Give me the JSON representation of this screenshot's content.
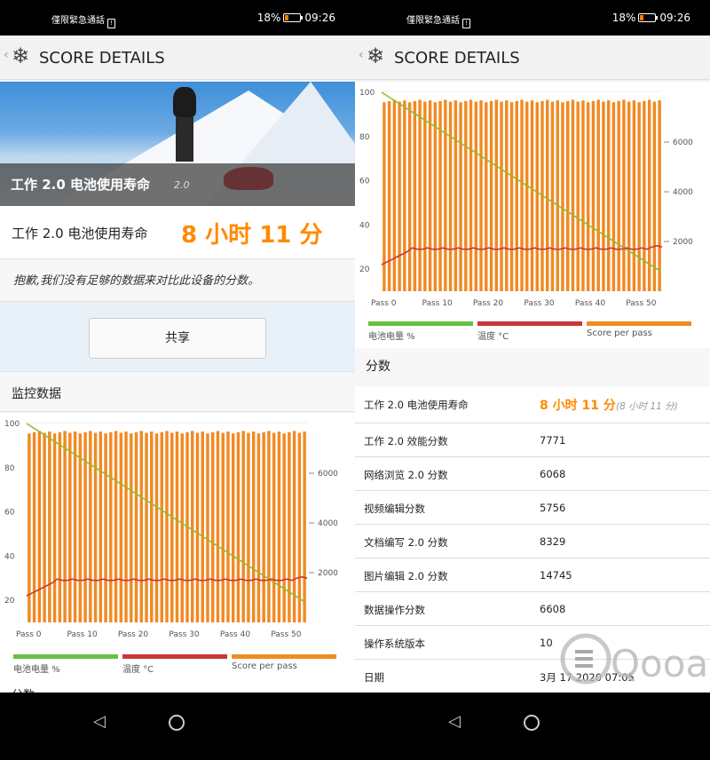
{
  "left": {
    "status": {
      "carrier": "僅限緊急通話",
      "sim_label": "!",
      "battery": "18%",
      "battery_level": 0.18,
      "time": "09:26"
    },
    "appbar": {
      "back": "‹",
      "icon": "snowflake-icon",
      "title": "SCORE DETAILS"
    },
    "hero": {
      "title": "工作 2.0 电池使用寿命",
      "version": "2.0"
    },
    "result": {
      "label": "工作 2.0 电池使用寿命",
      "value": "8 小时 11 分"
    },
    "sorry": "抱歉,我们没有足够的数据来对比此设备的分数。",
    "share_label": "共享",
    "monitor_title": "监控数据",
    "cut_heading": "分数",
    "legend": [
      {
        "label": "电池电量 %",
        "color": "#6abf40"
      },
      {
        "label": "温度 °C",
        "color": "#c8373a"
      },
      {
        "label": "Score per pass",
        "color": "#f08a24"
      }
    ]
  },
  "right": {
    "status": {
      "carrier": "僅限緊急通話",
      "sim_label": "!",
      "battery": "18%",
      "battery_level": 0.18,
      "time": "09:26"
    },
    "appbar": {
      "back": "‹",
      "icon": "snowflake-icon",
      "title": "SCORE DETAILS"
    },
    "legend": [
      {
        "label": "电池电量 %",
        "color": "#6abf40"
      },
      {
        "label": "温度 °C",
        "color": "#c8373a"
      },
      {
        "label": "Score per pass",
        "color": "#f08a24"
      }
    ],
    "score_heading": "分数",
    "rows": [
      {
        "key": "工作 2.0 电池使用寿命",
        "value": "8 小时 11 分",
        "sub": "(8 小时 11 分)"
      },
      {
        "key": "工作 2.0 效能分数",
        "value": "7771"
      },
      {
        "key": "网络浏览 2.0 分数",
        "value": "6068"
      },
      {
        "key": "视频编辑分数",
        "value": "5756"
      },
      {
        "key": "文档编写 2.0 分数",
        "value": "8329"
      },
      {
        "key": "图片编辑 2.0 分数",
        "value": "14745"
      },
      {
        "key": "数据操作分数",
        "value": "6608"
      },
      {
        "key": "操作系统版本",
        "value": "10"
      },
      {
        "key": "日期",
        "value": "3月 17 2020 07:05"
      }
    ],
    "watermark": "Qooah"
  },
  "chart_data": {
    "type": "bar",
    "passes": 55,
    "xtick_labels": [
      "Pass 0",
      "Pass 10",
      "Pass 20",
      "Pass 30",
      "Pass 40",
      "Pass 50"
    ],
    "left_ticks": [
      20,
      40,
      60,
      80,
      100
    ],
    "right_ticks": [
      2000,
      4000,
      6000
    ],
    "ylim_left": [
      10,
      100
    ],
    "ylim_right": [
      0,
      8000
    ],
    "series": [
      {
        "name": "Score per pass",
        "axis": "right",
        "value": 7650,
        "color": "#f08a24"
      },
      {
        "name": "电池电量 %",
        "axis": "left",
        "start": 100,
        "end": 19,
        "color": "#8fbf2a"
      },
      {
        "name": "温度 °C",
        "axis": "left",
        "start": 22,
        "plateau": 29,
        "end": 30,
        "color": "#c8373a"
      }
    ]
  },
  "navbar": {
    "back_icon": "nav-back-icon",
    "home_icon": "nav-home-icon"
  }
}
